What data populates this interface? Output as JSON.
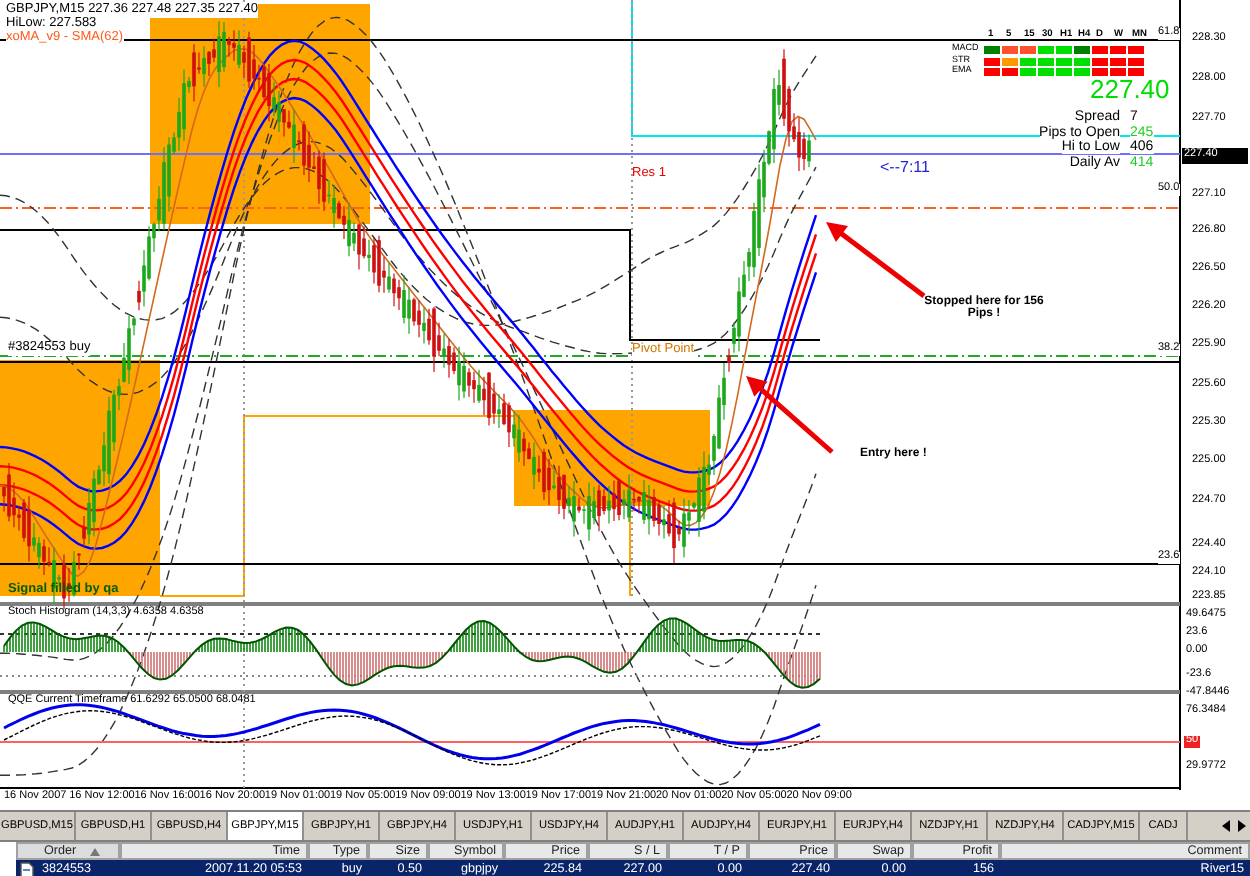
{
  "chart": {
    "header": {
      "symbol_line": "GBPJPY,M15 227.36 227.48 227.35 227.40",
      "hilow": "HiLow: 227.583",
      "indicator": "xoMA_v9 - SMA(62)"
    },
    "annotations": [
      {
        "kind": "order",
        "text": "#3824553 buy"
      },
      {
        "kind": "resistance",
        "text": "Res 1"
      },
      {
        "kind": "pivot",
        "text": "Pivot Point"
      },
      {
        "kind": "timer",
        "text": "<--7:11"
      },
      {
        "kind": "note",
        "text": "Stopped here for 156 Pips !"
      },
      {
        "kind": "entry",
        "text": "Entry here !"
      },
      {
        "kind": "signal",
        "text": "Signal filled by qa"
      }
    ],
    "fib_levels": [
      "61.8",
      "50.0",
      "38.2",
      "23.6"
    ],
    "price_axis": [
      "228.30",
      "228.00",
      "227.70",
      "227.10",
      "226.80",
      "226.50",
      "226.20",
      "225.90",
      "225.60",
      "225.30",
      "225.00",
      "224.70",
      "224.40",
      "224.10",
      "223.85"
    ],
    "current_price": "227.40",
    "dashboard": {
      "columns": [
        "1",
        "5",
        "15",
        "30",
        "H1",
        "H4",
        "D",
        "W",
        "MN"
      ],
      "rows": [
        {
          "name": "MACD",
          "cells": [
            {
              "color": "#008000"
            },
            {
              "color": "#ff5030"
            },
            {
              "color": "#ff5030"
            },
            {
              "color": "#00e000"
            },
            {
              "color": "#00e000"
            },
            {
              "color": "#008000"
            },
            {
              "color": "#ff0000"
            },
            {
              "color": "#ff0000"
            },
            {
              "color": "#ff0000"
            }
          ]
        },
        {
          "name": "STR",
          "cells": [
            {
              "color": "#ff0000"
            },
            {
              "color": "#ff9900"
            },
            {
              "color": "#00e000"
            },
            {
              "color": "#00e000"
            },
            {
              "color": "#00e000"
            },
            {
              "color": "#00e000"
            },
            {
              "color": "#ff0000"
            },
            {
              "color": "#ff0000"
            },
            {
              "color": "#ff0000"
            }
          ]
        },
        {
          "name": "EMA",
          "cells": [
            {
              "color": "#ff0000"
            },
            {
              "color": "#ff0000"
            },
            {
              "color": "#00e000"
            },
            {
              "color": "#00e000"
            },
            {
              "color": "#00e000"
            },
            {
              "color": "#00e000"
            },
            {
              "color": "#ff0000"
            },
            {
              "color": "#ff0000"
            },
            {
              "color": "#ff0000"
            }
          ]
        }
      ],
      "price": "227.40",
      "stats": [
        {
          "label": "Spread",
          "value": "7",
          "highlight": false
        },
        {
          "label": "Pips to Open",
          "value": "245",
          "highlight": true
        },
        {
          "label": "Hi to Low",
          "value": "406",
          "highlight": false
        },
        {
          "label": "Daily Av",
          "value": "414",
          "highlight": true
        }
      ]
    },
    "stoch": {
      "title": "Stoch Histogram (14,3,3) 4.6358 4.6358",
      "axis": [
        "49.6475",
        "23.6",
        "0.00",
        "-23.6",
        "-47.8446"
      ]
    },
    "qqe": {
      "title": "QQE Current Timeframe 61.6292 65.0500 68.0481",
      "axis": [
        "76.3484",
        "50",
        "29.9772"
      ]
    },
    "time_axis": [
      "16 Nov 2007",
      "16 Nov 12:00",
      "16 Nov 16:00",
      "16 Nov 20:00",
      "19 Nov 01:00",
      "19 Nov 05:00",
      "19 Nov 09:00",
      "19 Nov 13:00",
      "19 Nov 17:00",
      "19 Nov 21:00",
      "20 Nov 01:00",
      "20 Nov 05:00",
      "20 Nov 09:00"
    ]
  },
  "tabs": [
    {
      "label": "GBPUSD,M15",
      "selected": false
    },
    {
      "label": "GBPUSD,H1",
      "selected": false
    },
    {
      "label": "GBPUSD,H4",
      "selected": false
    },
    {
      "label": "GBPJPY,M15",
      "selected": true
    },
    {
      "label": "GBPJPY,H1",
      "selected": false
    },
    {
      "label": "GBPJPY,H4",
      "selected": false
    },
    {
      "label": "USDJPY,H1",
      "selected": false
    },
    {
      "label": "USDJPY,H4",
      "selected": false
    },
    {
      "label": "AUDJPY,H1",
      "selected": false
    },
    {
      "label": "AUDJPY,H4",
      "selected": false
    },
    {
      "label": "EURJPY,H1",
      "selected": false
    },
    {
      "label": "EURJPY,H4",
      "selected": false
    },
    {
      "label": "NZDJPY,H1",
      "selected": false
    },
    {
      "label": "NZDJPY,H4",
      "selected": false
    },
    {
      "label": "CADJPY,M15",
      "selected": false
    },
    {
      "label": "CADJ",
      "selected": false
    }
  ],
  "orders": {
    "columns": [
      {
        "label": "Order",
        "sorted": true
      },
      {
        "label": "Time",
        "sorted": false
      },
      {
        "label": "Type",
        "sorted": false
      },
      {
        "label": "Size",
        "sorted": false
      },
      {
        "label": "Symbol",
        "sorted": false
      },
      {
        "label": "Price",
        "sorted": false
      },
      {
        "label": "S / L",
        "sorted": false
      },
      {
        "label": "T / P",
        "sorted": false
      },
      {
        "label": "Price",
        "sorted": false
      },
      {
        "label": "Swap",
        "sorted": false
      },
      {
        "label": "Profit",
        "sorted": false
      },
      {
        "label": "Comment",
        "sorted": false
      }
    ],
    "rows": [
      {
        "selected": true,
        "cells": [
          "3824553",
          "2007.11.20 05:53",
          "buy",
          "0.50",
          "gbpjpy",
          "225.84",
          "227.00",
          "0.00",
          "227.40",
          "0.00",
          "156",
          "River15"
        ]
      }
    ]
  }
}
